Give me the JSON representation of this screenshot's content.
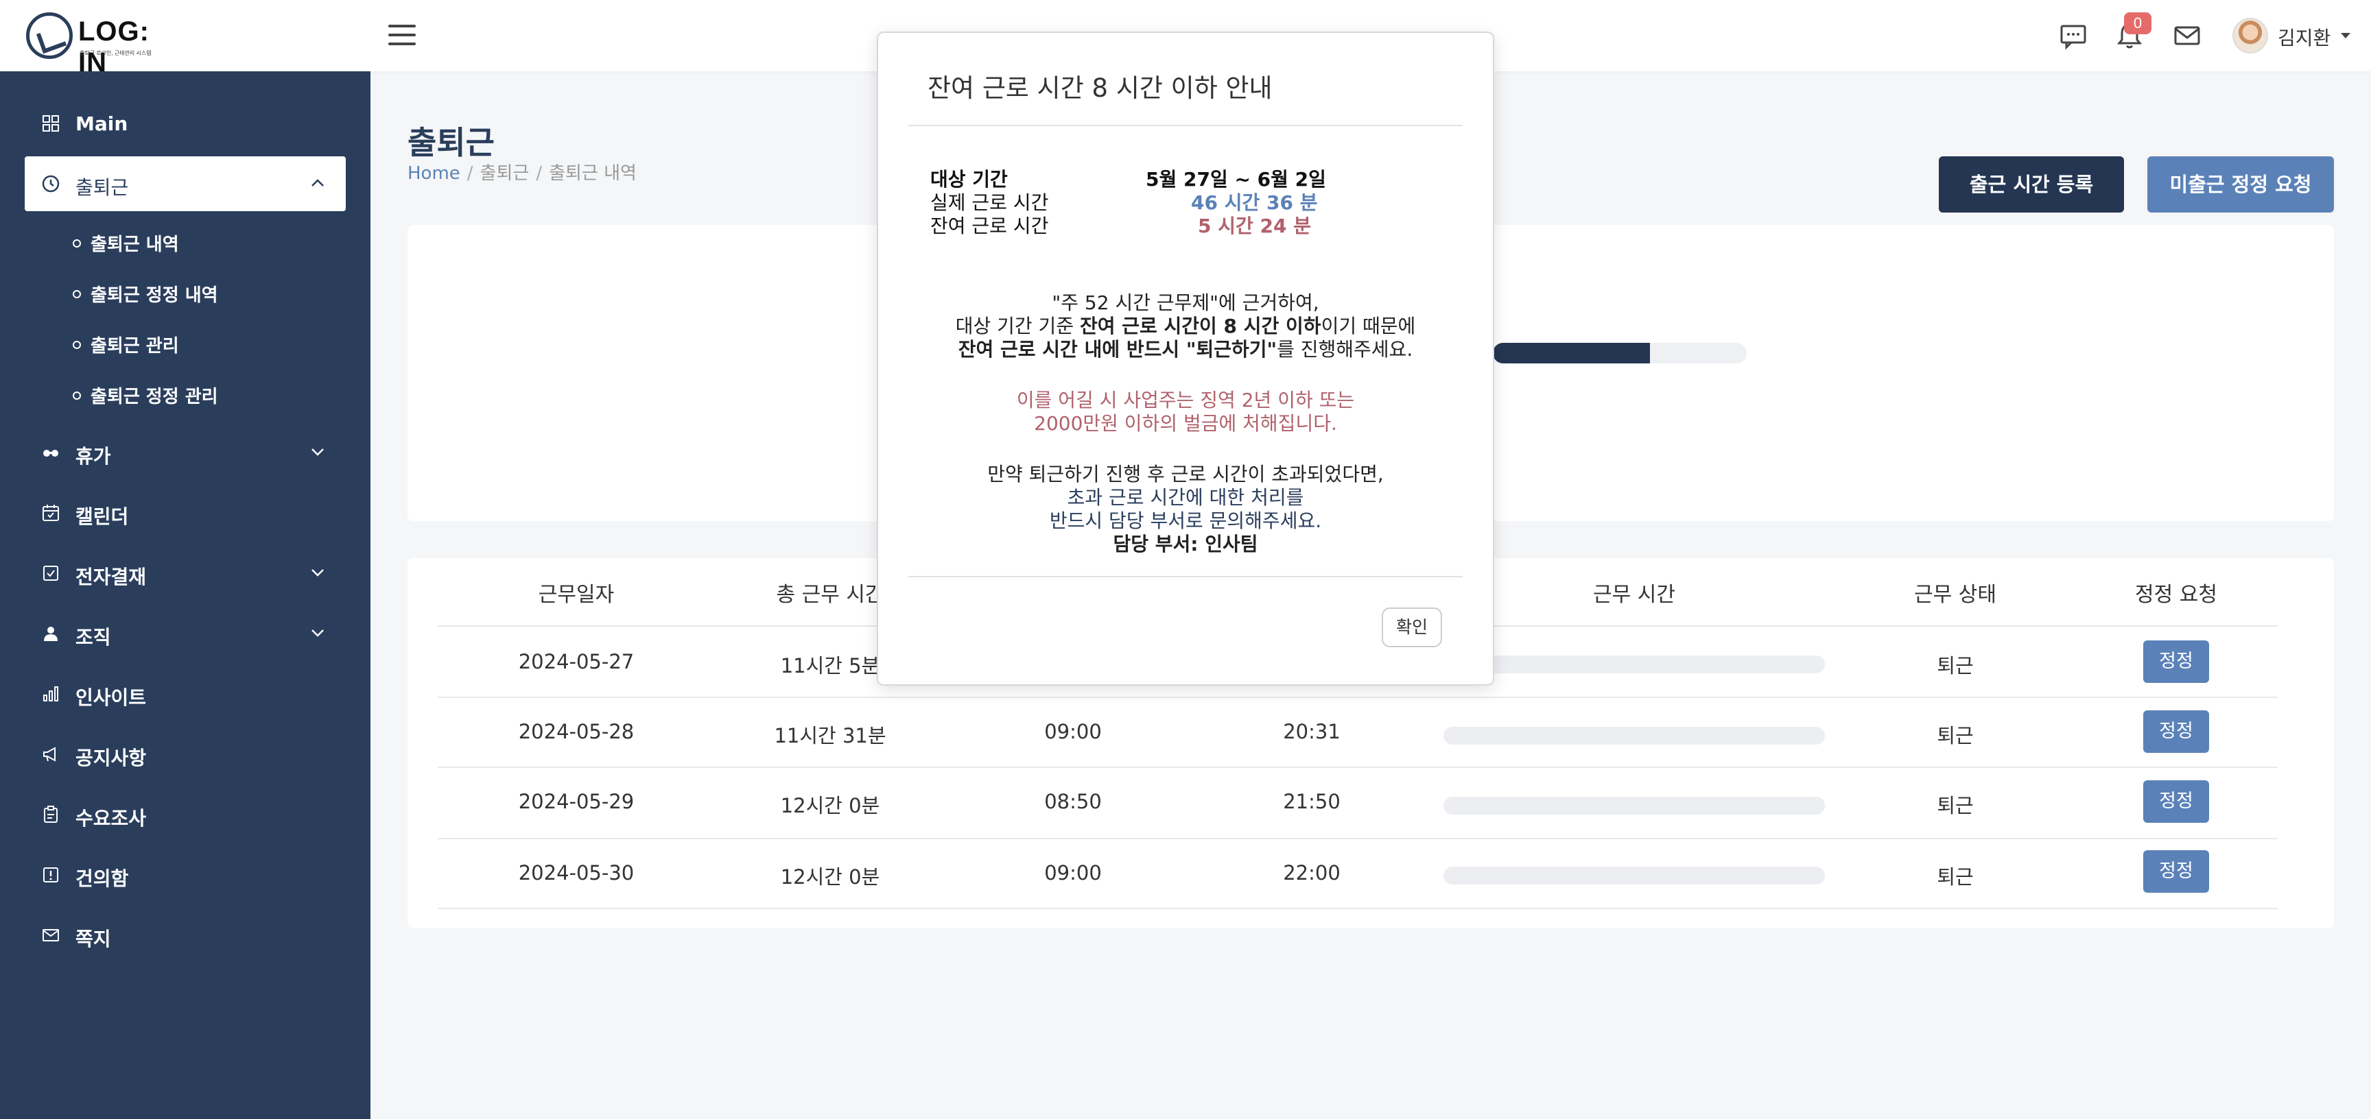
{
  "header": {
    "logo_text": "LOG: IN",
    "logo_subtext": "출퇴근 로그인, 근태관리 시스템",
    "notification_count": "0",
    "user_name": "김지환"
  },
  "sidebar": {
    "items": [
      {
        "label": "Main",
        "icon": "grid-icon"
      },
      {
        "label": "출퇴근",
        "icon": "clock-icon",
        "expanded": true
      },
      {
        "label": "휴가",
        "icon": "glasses-icon"
      },
      {
        "label": "캘린더",
        "icon": "calendar-icon"
      },
      {
        "label": "전자결재",
        "icon": "check-square-icon"
      },
      {
        "label": "조직",
        "icon": "person-icon"
      },
      {
        "label": "인사이트",
        "icon": "bar-chart-icon"
      },
      {
        "label": "공지사항",
        "icon": "megaphone-icon"
      },
      {
        "label": "수요조사",
        "icon": "clipboard-icon"
      },
      {
        "label": "건의함",
        "icon": "alert-square-icon"
      },
      {
        "label": "쪽지",
        "icon": "mail-icon"
      }
    ],
    "sub_items": [
      "출퇴근 내역",
      "출퇴근 정정 내역",
      "출퇴근 관리",
      "출퇴근 정정 관리"
    ]
  },
  "page": {
    "title": "출퇴근",
    "breadcrumb": [
      "Home",
      "출퇴근",
      "출퇴근 내역"
    ],
    "btn_register": "출근 시간 등록",
    "btn_request": "미출근 정정 요청",
    "progress_fraction": 0.62
  },
  "table": {
    "headers": [
      "근무일자",
      "총 근무 시간",
      "근무 시간",
      "근무 상태",
      "정정 요청"
    ],
    "rows": [
      {
        "date": "2024-05-27",
        "total": "11시간 5분",
        "start": "",
        "end": "",
        "status": "퇴근",
        "action": "정정"
      },
      {
        "date": "2024-05-28",
        "total": "11시간 31분",
        "start": "09:00",
        "end": "20:31",
        "status": "퇴근",
        "action": "정정"
      },
      {
        "date": "2024-05-29",
        "total": "12시간 0분",
        "start": "08:50",
        "end": "21:50",
        "status": "퇴근",
        "action": "정정"
      },
      {
        "date": "2024-05-30",
        "total": "12시간 0분",
        "start": "09:00",
        "end": "22:00",
        "status": "퇴근",
        "action": "정정"
      }
    ]
  },
  "modal": {
    "title": "잔여 근로 시간 8 시간 이하 안내",
    "period_label": "대상 기간",
    "period_value": "5월 27일 ~ 6월 2일",
    "actual_label": "실제 근로 시간",
    "actual_value": "46 시간 36 분",
    "remaining_label": "잔여 근로 시간",
    "remaining_value": "5 시간 24 분",
    "line1": "\"주 52 시간 근무제\"에 근거하여,",
    "line2_a": "대상 기간 기준 ",
    "line2_b": "잔여 근로 시간이 8 시간 이하",
    "line2_c": "이기 때문에",
    "line3_a": "잔여 근로 시간 내에 반드시 \"퇴근하기\"",
    "line3_b": "를 진행해주세요.",
    "warn1": "이를 어길 시 사업주는 징역 2년 이하 또는",
    "warn2": "2000만원 이하의 벌금에 처해집니다.",
    "note1": "만약 퇴근하기 진행 후 근로 시간이 초과되었다면,",
    "note2": "초과 근로 시간에 대한 처리를",
    "note3": "반드시 담당 부서로 문의해주세요.",
    "note4": "담당 부서: 인사팀",
    "confirm": "확인"
  },
  "colors": {
    "sidebar_bg": "#2a3e5c",
    "accent_blue": "#5b82b8",
    "dark_navy_button": "#243652",
    "actual_time_color": "#5b82b8",
    "remaining_time_color": "#b0616c",
    "notification_badge": "#e56b6b"
  }
}
